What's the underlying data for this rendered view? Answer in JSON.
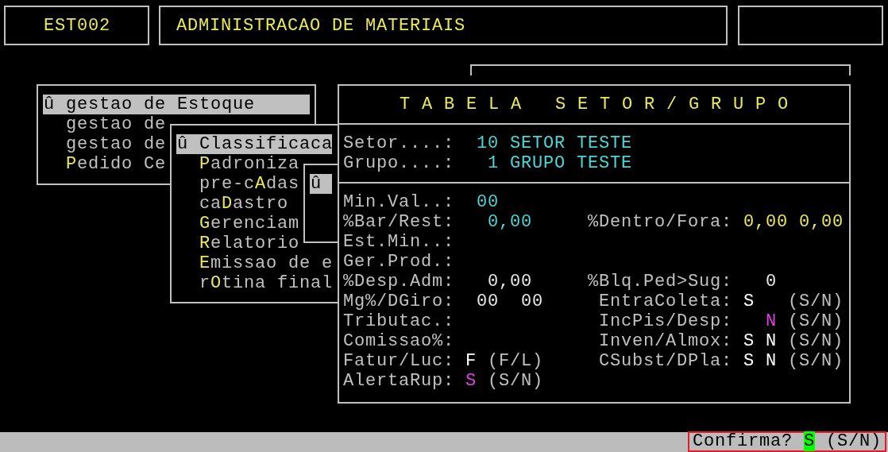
{
  "header": {
    "code": "EST002",
    "title": "ADMINISTRACAO DE MATERIAIS"
  },
  "menus": [
    {
      "cursor": "û",
      "items": [
        {
          "before": "gestao de Estoque",
          "selected": true
        },
        {
          "before": "gestao de",
          "selected": false
        },
        {
          "before": "gestao de",
          "selected": false
        },
        {
          "hotkey": "P",
          "after": "edido Ce",
          "selected": false
        }
      ]
    },
    {
      "cursor": "û",
      "items": [
        {
          "before": "Classificaca",
          "selected": true
        },
        {
          "hotkey": "P",
          "after": "adroniza",
          "selected": false
        },
        {
          "before": "pre-c",
          "hotkey": "A",
          "after": "das",
          "selected": false
        },
        {
          "before": "ca",
          "hotkey": "D",
          "after": "astro",
          "selected": false
        },
        {
          "hotkey": "G",
          "after": "erenciam",
          "selected": false
        },
        {
          "hotkey": "R",
          "after": "elatorio",
          "selected": false
        },
        {
          "hotkey": "E",
          "after": "missao de e",
          "selected": false
        },
        {
          "before": "r",
          "hotkey": "O",
          "after": "tina final",
          "selected": false
        }
      ]
    },
    {
      "cursor": "û",
      "items": [
        {
          "selected": true
        }
      ]
    }
  ],
  "panel": {
    "title": "T A B E L A   S E T O R / G R U P O",
    "key_rows": [
      {
        "label": "Setor....:",
        "code": "10",
        "name": "SETOR TESTE"
      },
      {
        "label": "Grupo....:",
        "code": "1",
        "name": "GRUPO TESTE"
      }
    ],
    "rows": [
      {
        "left": {
          "kind": "code",
          "label": "Min.Val..:",
          "values": [
            {
              "text": "00",
              "color": "#4ad6d6"
            }
          ]
        }
      },
      {
        "left": {
          "kind": "amount",
          "label": "%Bar/Rest:",
          "values": [
            {
              "text": "0,00",
              "color": "#4ad6d6"
            }
          ]
        },
        "right": {
          "kind": "pair",
          "label": "%Dentro/Fora:",
          "values": [
            {
              "text": "0,00",
              "color": "#e8e858"
            },
            {
              "text": "0,00",
              "color": "#e8e858"
            }
          ]
        }
      },
      {
        "left": {
          "kind": "blank",
          "label": "Est.Min..:"
        }
      },
      {
        "left": {
          "kind": "blank",
          "label": "Ger.Prod.:"
        }
      },
      {
        "left": {
          "kind": "amount",
          "label": "%Desp.Adm:",
          "values": [
            {
              "text": "0,00",
              "color": "#e8e8e8"
            }
          ]
        },
        "right": {
          "kind": "single",
          "label": "%Blq.Ped>Sug:",
          "values": [
            {
              "text": "0",
              "color": "#e8e8e8"
            }
          ]
        }
      },
      {
        "left": {
          "kind": "pair",
          "label": "Mg%/DGiro:",
          "values": [
            {
              "text": "00",
              "color": "#e8e8e8"
            },
            {
              "text": "00",
              "color": "#e8e8e8"
            }
          ]
        },
        "right": {
          "kind": "flags",
          "label": "EntraColeta:",
          "flag_1": {
            "text": "S",
            "color": "#ffffff"
          },
          "options": "(S/N)"
        }
      },
      {
        "left": {
          "kind": "blank",
          "label": "Tributac.:"
        },
        "right": {
          "kind": "flags",
          "label": "IncPis/Desp:",
          "flag_2": {
            "text": "N",
            "color": "#e040e0"
          },
          "options": "(S/N)"
        }
      },
      {
        "left": {
          "kind": "blank",
          "label": "Comissao%:"
        },
        "right": {
          "kind": "flags",
          "label": "Inven/Almox:",
          "flag_1": {
            "text": "S",
            "color": "#ffffff"
          },
          "flag_2": {
            "text": "N",
            "color": "#ffffff"
          },
          "options": "(S/N)"
        }
      },
      {
        "left": {
          "kind": "flag",
          "label": "Fatur/Luc:",
          "values": [
            {
              "text": "F",
              "color": "#ffffff"
            }
          ],
          "options": "(F/L)"
        },
        "right": {
          "kind": "flags",
          "label": "CSubst/DPla:",
          "flag_1": {
            "text": "S",
            "color": "#ffffff"
          },
          "flag_2": {
            "text": "N",
            "color": "#ffffff"
          },
          "options": "(S/N)"
        }
      },
      {
        "left": {
          "kind": "flag",
          "label": "AlertaRup:",
          "values": [
            {
              "text": "S",
              "color": "#e040e0"
            }
          ],
          "options": "(S/N)"
        }
      }
    ]
  },
  "status_bar": {
    "prompt": "Confirma?",
    "answer": "S",
    "options": "(S/N)"
  }
}
